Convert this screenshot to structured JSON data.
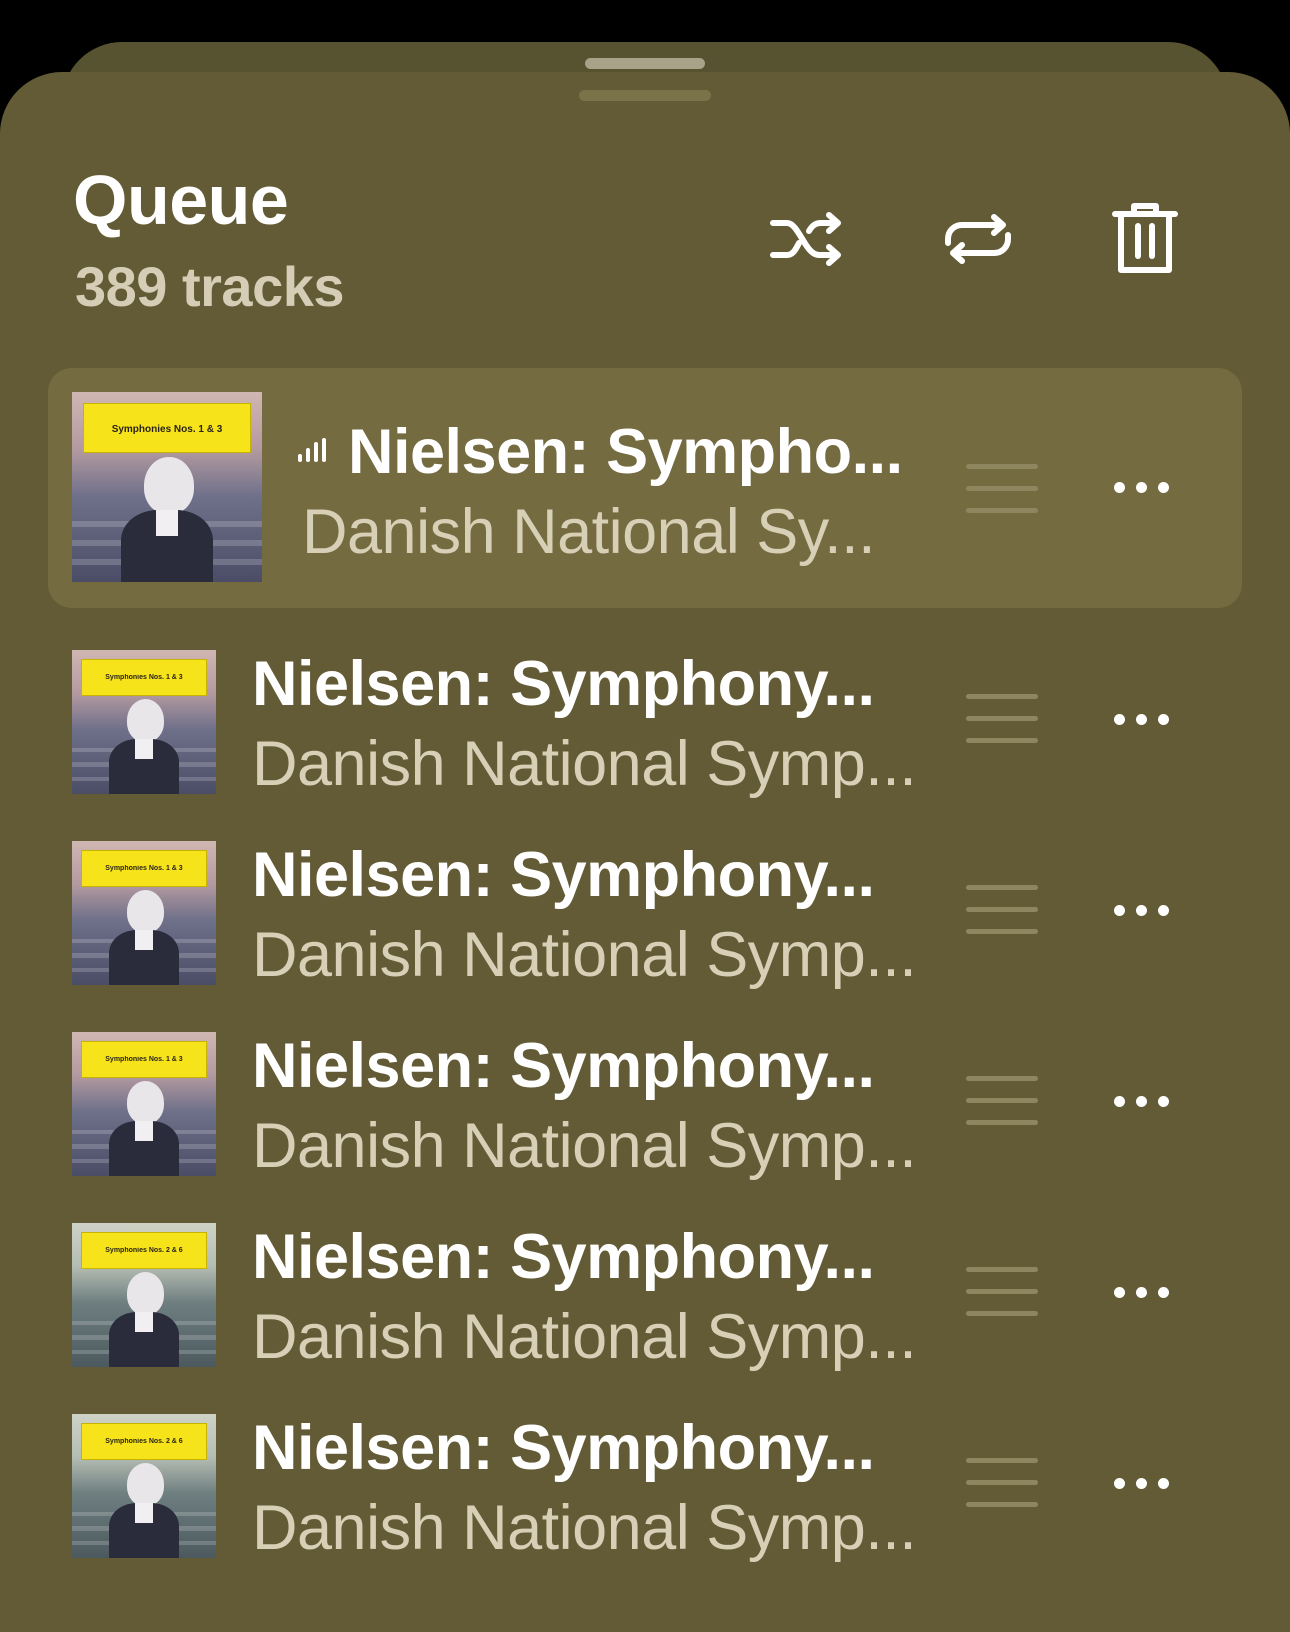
{
  "queue": {
    "title": "Queue",
    "track_count": "389 tracks",
    "controls": [
      "shuffle-icon",
      "repeat-icon",
      "trash-icon"
    ]
  },
  "tracks": [
    {
      "title": "Nielsen: Sympho...",
      "artist": "Danish National Sy...",
      "now_playing": true,
      "album_caption": "Symphonies Nos. 1 & 3"
    },
    {
      "title": "Nielsen: Symphony...",
      "artist": "Danish National Symp...",
      "now_playing": false,
      "album_caption": "Symphonies Nos. 1 & 3"
    },
    {
      "title": "Nielsen: Symphony...",
      "artist": "Danish National Symp...",
      "now_playing": false,
      "album_caption": "Symphonies Nos. 1 & 3"
    },
    {
      "title": "Nielsen: Symphony...",
      "artist": "Danish National Symp...",
      "now_playing": false,
      "album_caption": "Symphonies Nos. 1 & 3"
    },
    {
      "title": "Nielsen: Symphony...",
      "artist": "Danish National Symp...",
      "now_playing": false,
      "album_caption": "Symphonies Nos. 2 & 6"
    },
    {
      "title": "Nielsen: Symphony...",
      "artist": "Danish National Symp...",
      "now_playing": false,
      "album_caption": "Symphonies Nos. 2 & 6"
    }
  ],
  "colors": {
    "background": "#000000",
    "sheet": "#635b35",
    "current_row": "#756b40",
    "title_text": "#ffffff",
    "secondary_text": "#d8cfb7",
    "album_label": "#f6e31a"
  }
}
